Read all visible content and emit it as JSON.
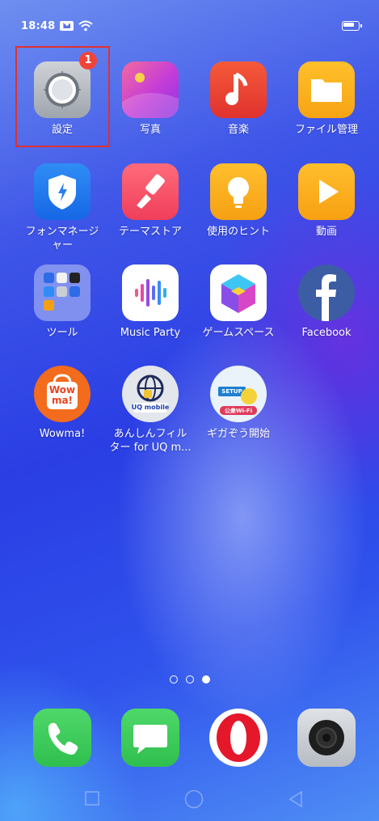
{
  "status_bar": {
    "time": "18:48"
  },
  "apps": {
    "settings": {
      "label": "設定",
      "badge": "1"
    },
    "photos": {
      "label": "写真"
    },
    "music": {
      "label": "音楽"
    },
    "file_manager": {
      "label": "ファイル管理"
    },
    "phone_manager": {
      "label": "フォンマネージ\nャー"
    },
    "theme_store": {
      "label": "テーマストア"
    },
    "tips": {
      "label": "使用のヒント"
    },
    "video": {
      "label": "動画"
    },
    "tools": {
      "label": "ツール"
    },
    "music_party": {
      "label": "Music Party"
    },
    "game_space": {
      "label": "ゲームスペース"
    },
    "facebook": {
      "label": "Facebook"
    },
    "wowma": {
      "label": "Wowma!",
      "icon_text": "Wow\nma!"
    },
    "anshin_filter": {
      "label": "あんしんフィル\nター for UQ m...",
      "icon_text": "UQ mobile"
    },
    "giga_zou": {
      "label": "ギガぞう開始",
      "icon_text_1": "SETUP",
      "icon_text_2": "公衆Wi-Fi"
    }
  },
  "page_indicator": {
    "pages": 3,
    "current": 3
  },
  "dock": [
    "phone-icon",
    "messages-icon",
    "opera-icon",
    "camera-icon"
  ],
  "nav": [
    "recents-button",
    "home-button",
    "back-button"
  ],
  "colors": {
    "badge": "#f04438",
    "highlight": "#e03030"
  }
}
